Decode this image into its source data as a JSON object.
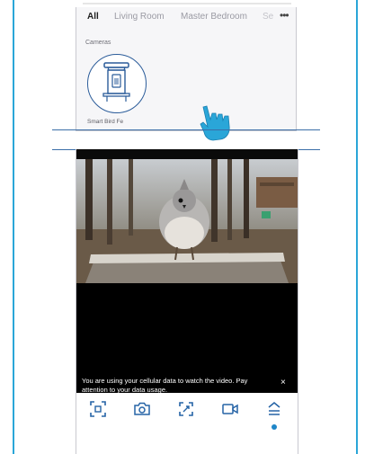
{
  "room_tabs": {
    "all": "All",
    "living_room": "Living Room",
    "master_bedroom": "Master Bedroom",
    "more_partial": "Se",
    "more_menu": "•••"
  },
  "cameras": {
    "section_label": "Cameras",
    "device_name": "Smart Bird Fe"
  },
  "live_view": {
    "notice": "You are using your cellular data to watch the video. Pay attention to your data usage.",
    "close_symbol": "×"
  },
  "controls": [
    "scan-icon",
    "camera-icon",
    "fullscreen-icon",
    "video-record-icon",
    "expand-up-icon"
  ],
  "colors": {
    "accent": "#2aa6d8",
    "icon_blue": "#2563a6",
    "outline_blue": "#2b5c9a"
  }
}
